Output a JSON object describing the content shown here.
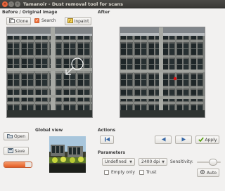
{
  "window": {
    "title": "Tamanoir - Dust removal tool for scans",
    "close_glyph": "×",
    "min_glyph": "–",
    "max_glyph": "+"
  },
  "before": {
    "label": "Before / Original image",
    "clone_label": "Clone",
    "search_label": "Search",
    "search_checked": true,
    "inpaint_label": "Inpaint"
  },
  "after": {
    "label": "After"
  },
  "file": {
    "open_label": "Open",
    "save_label": "Save",
    "progress": 0.78
  },
  "global_view": {
    "label": "Global view"
  },
  "actions": {
    "label": "Actions",
    "apply_label": "Apply",
    "icons": [
      "first-icon",
      "previous-icon",
      "next-icon",
      "apply-check-icon"
    ]
  },
  "parameters": {
    "label": "Parameters",
    "film_type": "Undefined",
    "dpi": "2400 dpi",
    "sensitivity_label": "Sensitivity:",
    "sensitivity_level": 0.75,
    "empty_only_label": "Empty only",
    "empty_only_checked": false,
    "trust_label": "Trust",
    "trust_checked": false,
    "auto_label": "Auto"
  },
  "colors": {
    "accent": "#e35c24",
    "titlebar": "#3a3936",
    "window_bg": "#f2f1f0",
    "apply_green": "#4e9a06",
    "nav_blue": "#3465a4",
    "dust_marker": "#e01010"
  }
}
